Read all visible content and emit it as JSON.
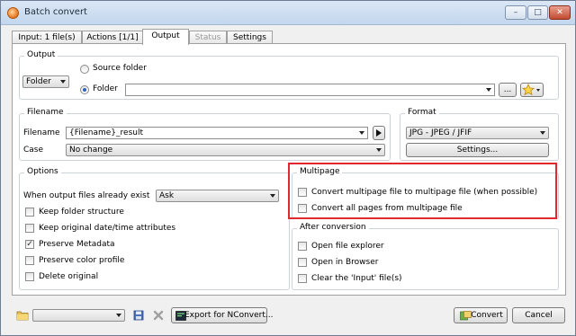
{
  "window": {
    "title": "Batch convert",
    "caption_min": "–",
    "caption_max": "□",
    "caption_close": "✕"
  },
  "tabs": [
    {
      "label": "Input: 1 file(s)"
    },
    {
      "label": "Actions [1/1]"
    },
    {
      "label": "Output"
    },
    {
      "label": "Status"
    },
    {
      "label": "Settings"
    }
  ],
  "output": {
    "group_title": "Output",
    "folder_combo": "Folder",
    "source_folder_label": "Source folder",
    "folder_label": "Folder",
    "folder_value": "",
    "browse_label": "...",
    "favorite_icon": "star-icon"
  },
  "filename": {
    "group_title": "Filename",
    "filename_label": "Filename",
    "filename_value": "{Filename}_result",
    "case_label": "Case",
    "case_value": "No change"
  },
  "format": {
    "group_title": "Format",
    "format_value": "JPG - JPEG / JFIF",
    "settings_label": "Settings..."
  },
  "options": {
    "group_title": "Options",
    "existing_label": "When output files already exist",
    "existing_value": "Ask",
    "items": [
      {
        "label": "Keep folder structure",
        "checked": false
      },
      {
        "label": "Keep original date/time attributes",
        "checked": false
      },
      {
        "label": "Preserve Metadata",
        "checked": true
      },
      {
        "label": "Preserve color profile",
        "checked": false
      },
      {
        "label": "Delete original",
        "checked": false
      }
    ]
  },
  "multipage": {
    "group_title": "Multipage",
    "items": [
      {
        "label": "Convert multipage file to multipage file (when possible)",
        "checked": false
      },
      {
        "label": "Convert all pages from multipage file",
        "checked": false
      }
    ],
    "highlight_color": "#e0282d"
  },
  "after_conversion": {
    "group_title": "After conversion",
    "items": [
      {
        "label": "Open file explorer",
        "checked": false
      },
      {
        "label": "Open in Browser",
        "checked": false
      },
      {
        "label": "Clear the 'Input' file(s)",
        "checked": false
      }
    ]
  },
  "bottom": {
    "preset_value": "",
    "export_label": "Export for NConvert...",
    "convert_label": "Convert",
    "cancel_label": "Cancel"
  },
  "check_glyph": "✓"
}
